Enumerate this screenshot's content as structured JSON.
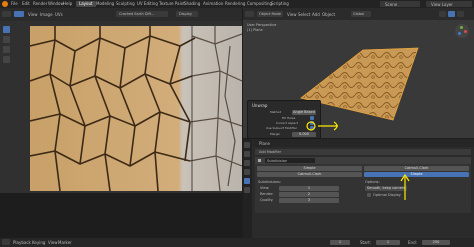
{
  "topbar": {
    "menus": [
      "File",
      "Edit",
      "Render",
      "Window",
      "Help"
    ],
    "workspaces": [
      "Layout",
      "Modeling",
      "Sculpting",
      "UV Editing",
      "Texture Paint",
      "Shading",
      "Animation",
      "Rendering",
      "Compositing",
      "Scripting"
    ],
    "active_workspace": "Layout",
    "scene": "Scene",
    "view_layer": "View Layer"
  },
  "image_editor": {
    "header_items": [
      "View",
      "Image",
      "UVs"
    ],
    "image_name": "Cracked Earth Diff...",
    "slot": "Display"
  },
  "viewport": {
    "view_label": "User Perspective",
    "collection_label": "(1) Plane",
    "header_items": [
      "View",
      "Select",
      "Add",
      "Object"
    ],
    "mode": "Object Mode",
    "shading": "Global"
  },
  "unwrap_panel": {
    "title": "Unwrap",
    "rows": [
      {
        "label": "Method",
        "value": "Angle Based"
      },
      {
        "label": "Fill Holes",
        "value": ""
      },
      {
        "label": "Correct Aspect",
        "value": ""
      },
      {
        "label": "Use Subsurf Modifier",
        "value": ""
      },
      {
        "label": "Margin",
        "value": "0.000"
      }
    ]
  },
  "properties": {
    "object_name": "Plane",
    "add_modifier": "Add Modifier",
    "modifier_name": "Subdivision",
    "mode_left": "Simple",
    "mode_right": "Catmull-Clark",
    "apply_left": "Catmull-Clark",
    "apply_right": "Simple",
    "subdivisions_label": "Subdivisions:",
    "options_label": "Options:",
    "levels": [
      {
        "label": "View:",
        "value": "1"
      },
      {
        "label": "Render:",
        "value": "2"
      },
      {
        "label": "Quality:",
        "value": "3"
      }
    ],
    "options": [
      {
        "label": "Smooth, keep corners"
      },
      {
        "label": "Optimal Display"
      }
    ]
  },
  "timeline": {
    "items": [
      "Playback",
      "Keying",
      "View",
      "Marker"
    ],
    "frame": "1",
    "start_label": "Start:",
    "start": "1",
    "end_label": "End:",
    "end": "250"
  },
  "colors": {
    "accent": "#4772b3",
    "annotation": "#ffe800"
  }
}
